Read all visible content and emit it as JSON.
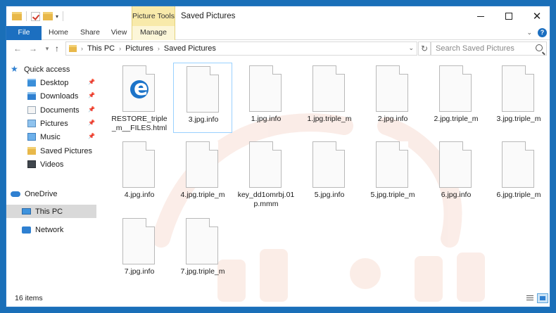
{
  "window": {
    "title": "Saved Pictures",
    "context_tab_group": "Picture Tools"
  },
  "ribbon": {
    "tabs": [
      "File",
      "Home",
      "Share",
      "View",
      "Manage"
    ]
  },
  "address": {
    "crumbs": [
      "This PC",
      "Pictures",
      "Saved Pictures"
    ],
    "search_placeholder": "Search Saved Pictures"
  },
  "sidebar": {
    "items": [
      {
        "label": "Quick access",
        "icon": "star-icon",
        "pinned": false
      },
      {
        "label": "Desktop",
        "icon": "desktop-folder-icon",
        "pinned": true
      },
      {
        "label": "Downloads",
        "icon": "downloads-folder-icon",
        "pinned": true
      },
      {
        "label": "Documents",
        "icon": "documents-folder-icon",
        "pinned": true
      },
      {
        "label": "Pictures",
        "icon": "pictures-folder-icon",
        "pinned": true
      },
      {
        "label": "Music",
        "icon": "music-folder-icon",
        "pinned": true
      },
      {
        "label": "Saved Pictures",
        "icon": "folder-icon",
        "pinned": false
      },
      {
        "label": "Videos",
        "icon": "videos-folder-icon",
        "pinned": false
      },
      {
        "label": "OneDrive",
        "icon": "onedrive-icon",
        "pinned": false
      },
      {
        "label": "This PC",
        "icon": "this-pc-icon",
        "pinned": false
      },
      {
        "label": "Network",
        "icon": "network-icon",
        "pinned": false
      }
    ],
    "selected": "This PC"
  },
  "files": [
    {
      "name": "RESTORE_triple_m__FILES.html",
      "icon": "edge-html-icon"
    },
    {
      "name": "3.jpg.info",
      "icon": "blank-file-icon",
      "selected": true
    },
    {
      "name": "1.jpg.info",
      "icon": "blank-file-icon"
    },
    {
      "name": "1.jpg.triple_m",
      "icon": "blank-file-icon"
    },
    {
      "name": "2.jpg.info",
      "icon": "blank-file-icon"
    },
    {
      "name": "2.jpg.triple_m",
      "icon": "blank-file-icon"
    },
    {
      "name": "3.jpg.triple_m",
      "icon": "blank-file-icon"
    },
    {
      "name": "4.jpg.info",
      "icon": "blank-file-icon"
    },
    {
      "name": "4.jpg.triple_m",
      "icon": "blank-file-icon"
    },
    {
      "name": "key_dd1omrbj.01p.mmm",
      "icon": "blank-file-icon"
    },
    {
      "name": "5.jpg.info",
      "icon": "blank-file-icon"
    },
    {
      "name": "5.jpg.triple_m",
      "icon": "blank-file-icon"
    },
    {
      "name": "6.jpg.info",
      "icon": "blank-file-icon"
    },
    {
      "name": "6.jpg.triple_m",
      "icon": "blank-file-icon"
    },
    {
      "name": "7.jpg.info",
      "icon": "blank-file-icon"
    },
    {
      "name": "7.jpg.triple_m",
      "icon": "blank-file-icon"
    }
  ],
  "status": {
    "item_count": "16 items"
  },
  "colors": {
    "accent": "#1c6fc0",
    "picture_tools": "#f8eaaa",
    "selection": "#99d1ff",
    "folder": "#e8b84a"
  }
}
